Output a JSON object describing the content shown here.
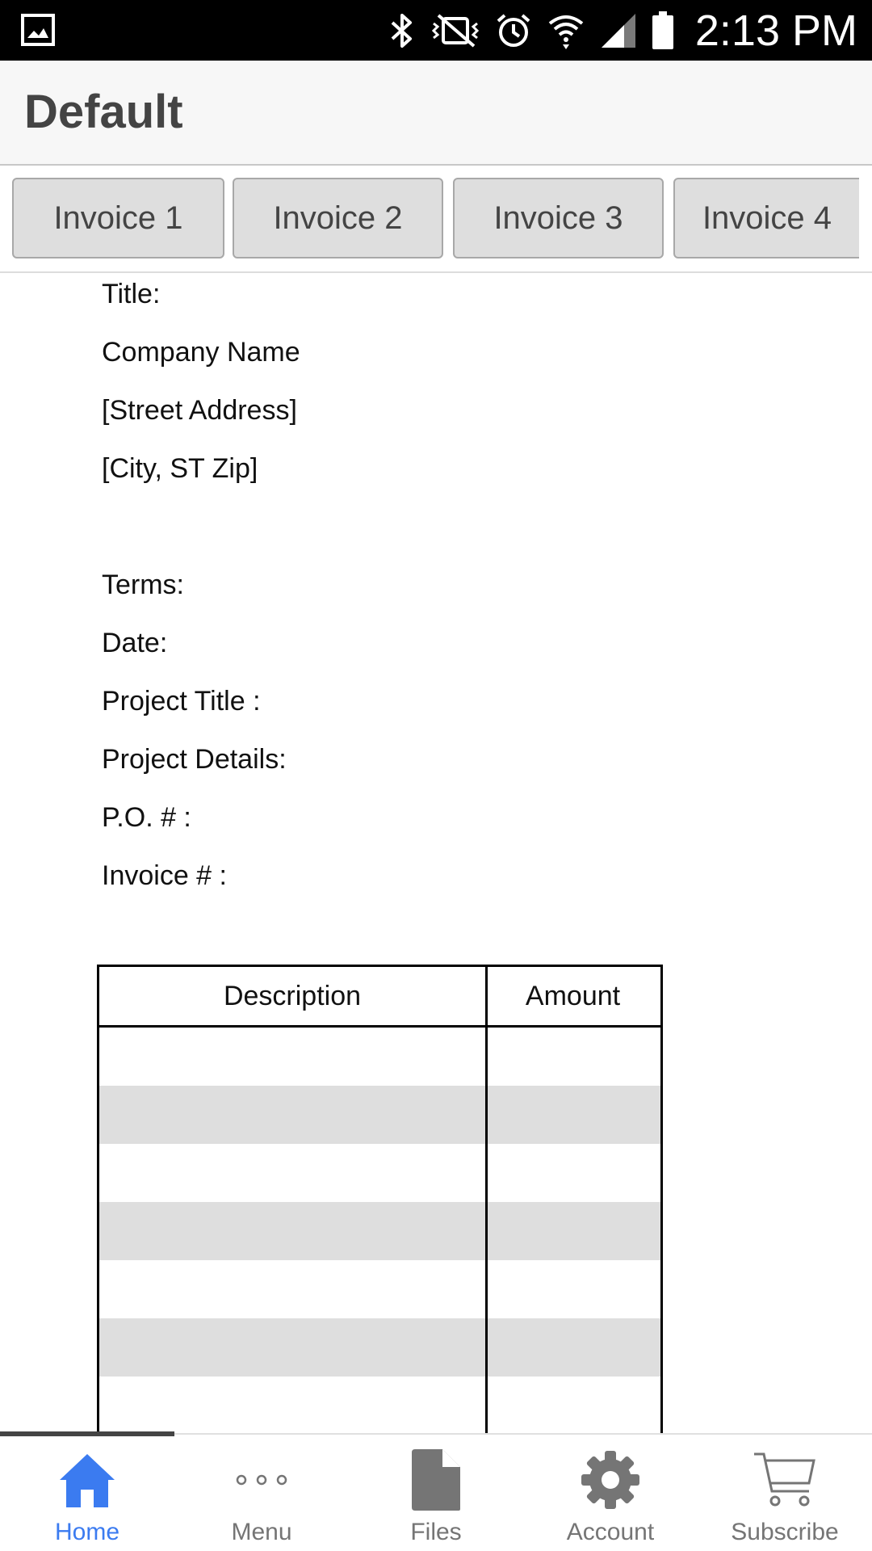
{
  "status_bar": {
    "time": "2:13 PM",
    "icons": [
      "image-icon",
      "bluetooth-icon",
      "vibrate-mute-icon",
      "alarm-icon",
      "wifi-icon",
      "signal-icon",
      "battery-icon"
    ]
  },
  "header": {
    "title": "Default"
  },
  "tabs": [
    {
      "label": "Invoice 1"
    },
    {
      "label": "Invoice 2"
    },
    {
      "label": "Invoice 3"
    },
    {
      "label": "Invoice 4"
    }
  ],
  "invoice": {
    "title_label": "Title:",
    "company_name": "Company Name",
    "street_address": "[Street Address]",
    "city_state_zip": "[City, ST Zip]",
    "terms_label": "Terms:",
    "date_label": "Date:",
    "project_title_label": "Project Title :",
    "project_details_label": "Project Details:",
    "po_label": "P.O. # :",
    "invoice_number_label": "Invoice # :"
  },
  "table": {
    "headers": [
      "Description",
      "Amount"
    ],
    "rows": [
      {
        "description": "",
        "amount": "",
        "shaded": false
      },
      {
        "description": "",
        "amount": "",
        "shaded": true
      },
      {
        "description": "",
        "amount": "",
        "shaded": false
      },
      {
        "description": "",
        "amount": "",
        "shaded": true
      },
      {
        "description": "",
        "amount": "",
        "shaded": false
      },
      {
        "description": "",
        "amount": "",
        "shaded": true
      },
      {
        "description": "",
        "amount": "",
        "shaded": false
      }
    ]
  },
  "bottom_nav": {
    "active": "Home",
    "active_color": "#3b7bf0",
    "items": [
      {
        "label": "Home",
        "icon": "home-icon"
      },
      {
        "label": "Menu",
        "icon": "more-dots-icon"
      },
      {
        "label": "Files",
        "icon": "file-icon"
      },
      {
        "label": "Account",
        "icon": "gear-icon"
      },
      {
        "label": "Subscribe",
        "icon": "cart-icon"
      }
    ]
  }
}
